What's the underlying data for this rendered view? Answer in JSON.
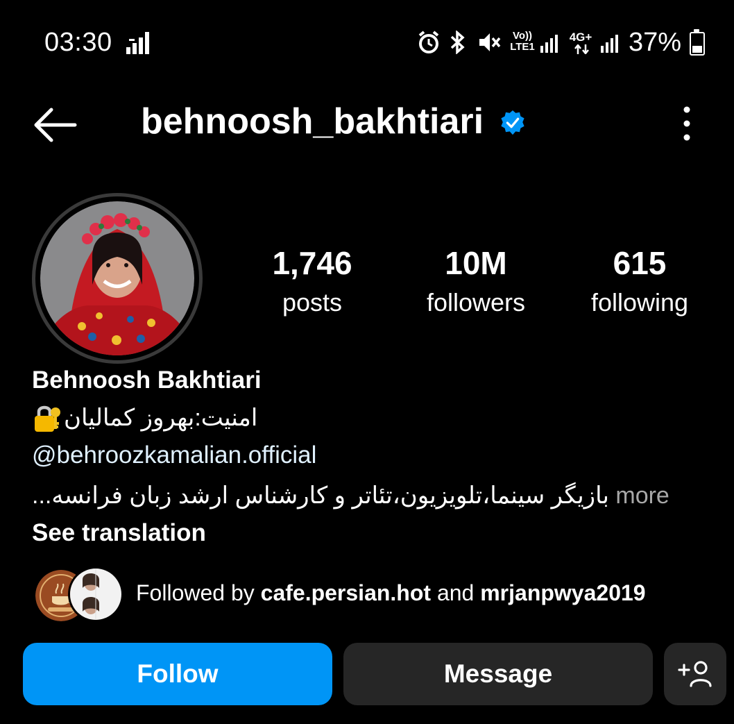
{
  "status_bar": {
    "time": "03:30",
    "battery_percent": "37%",
    "network_labels": [
      "Vo)) LTE1",
      "4G+"
    ]
  },
  "header": {
    "username": "behnoosh_bakhtiari",
    "verified": true
  },
  "stats": {
    "posts": {
      "value": "1,746",
      "label": "posts"
    },
    "followers": {
      "value": "10M",
      "label": "followers"
    },
    "following": {
      "value": "615",
      "label": "following"
    }
  },
  "bio": {
    "full_name": "Behnoosh Bakhtiari",
    "line1": "امنیت:بهروز کمالیان",
    "mention": "@behroozkamalian.official",
    "line3": "بازیگر سینما،تلویزیون،تئاتر و کارشناس ارشد زبان فرانسه...",
    "more_label": "more",
    "see_translation": "See translation"
  },
  "followed_by": {
    "prefix": "Followed by",
    "user1": "cafe.persian.hot",
    "conjunction": "and",
    "user2": "mrjanpwya2019"
  },
  "buttons": {
    "follow": "Follow",
    "message": "Message"
  },
  "colors": {
    "background": "#000000",
    "follow_button": "#0095f6",
    "secondary_button": "#262626",
    "verified_badge": "#0095f6",
    "mention_text": "#e0f1ff"
  }
}
